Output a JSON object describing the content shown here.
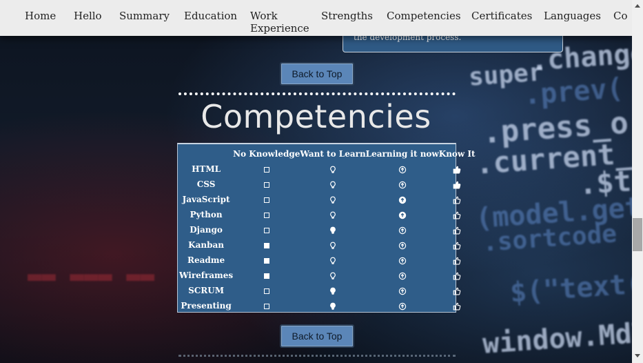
{
  "nav": {
    "items": [
      "Home",
      "Hello",
      "Summary",
      "Education",
      "Work Experience",
      "Strengths",
      "Competencies",
      "Certificates",
      "Languages",
      "Co"
    ]
  },
  "prev_panel": {
    "text": "the development process."
  },
  "back_to_top": "Back to Top",
  "section_title": "Competencies",
  "competencies": {
    "headers": [
      "No Knowledge",
      "Want to Learn",
      "Learning it now",
      "Know It"
    ],
    "rows": [
      {
        "skill": "HTML",
        "level": "Know It"
      },
      {
        "skill": "CSS",
        "level": "Know It"
      },
      {
        "skill": "JavaScript",
        "level": "Learning it now"
      },
      {
        "skill": "Python",
        "level": "Learning it now"
      },
      {
        "skill": "Django",
        "level": "Want to Learn"
      },
      {
        "skill": "Kanban",
        "level": "No Knowledge"
      },
      {
        "skill": "Readme",
        "level": "No Knowledge"
      },
      {
        "skill": "Wireframes",
        "level": "No Knowledge"
      },
      {
        "skill": "SCRUM",
        "level": "Want to Learn"
      },
      {
        "skill": "Presenting",
        "level": "Want to Learn"
      }
    ]
  },
  "background_code": [
    ".change",
    ".prev(",
    ".press_o",
    ".current_",
    ".$t",
    "(model.get(",
    ".sortcode",
    "$(\"text(",
    "window.MdTogg",
    "super"
  ],
  "colors": {
    "panel": "#2f5d89",
    "button": "#5b86b8",
    "nav": "#ececec"
  }
}
